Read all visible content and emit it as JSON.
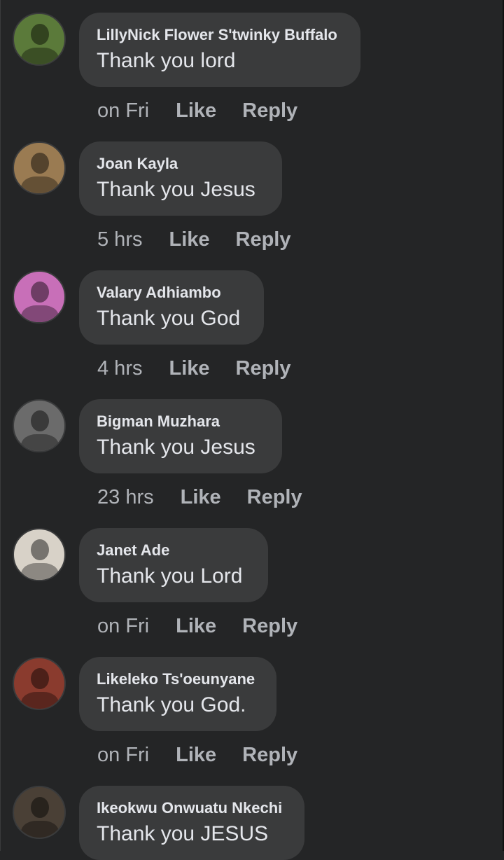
{
  "comments": [
    {
      "author": "LillyNick Flower S'twinky Buffalo",
      "text": "Thank you lord",
      "time": "on Fri",
      "like_label": "Like",
      "reply_label": "Reply",
      "avatar_color": "#5b7a3a"
    },
    {
      "author": "Joan Kayla",
      "text": "Thank you Jesus",
      "time": "5 hrs",
      "like_label": "Like",
      "reply_label": "Reply",
      "avatar_color": "#9a7b52"
    },
    {
      "author": "Valary Adhiambo",
      "text": "Thank you God",
      "time": "4 hrs",
      "like_label": "Like",
      "reply_label": "Reply",
      "avatar_color": "#c86fb8"
    },
    {
      "author": "Bigman Muzhara",
      "text": "Thank you Jesus",
      "time": "23 hrs",
      "like_label": "Like",
      "reply_label": "Reply",
      "avatar_color": "#6b6b6b"
    },
    {
      "author": "Janet Ade",
      "text": "Thank you Lord",
      "time": "on Fri",
      "like_label": "Like",
      "reply_label": "Reply",
      "avatar_color": "#d8d2c8"
    },
    {
      "author": "Likeleko Ts'oeunyane",
      "text": "Thank you God.",
      "time": "on Fri",
      "like_label": "Like",
      "reply_label": "Reply",
      "avatar_color": "#8a3b2e"
    },
    {
      "author": "Ikeokwu Onwuatu Nkechi",
      "text": "Thank you JESUS",
      "time": "",
      "like_label": "",
      "reply_label": "",
      "avatar_color": "#4a4036"
    }
  ]
}
